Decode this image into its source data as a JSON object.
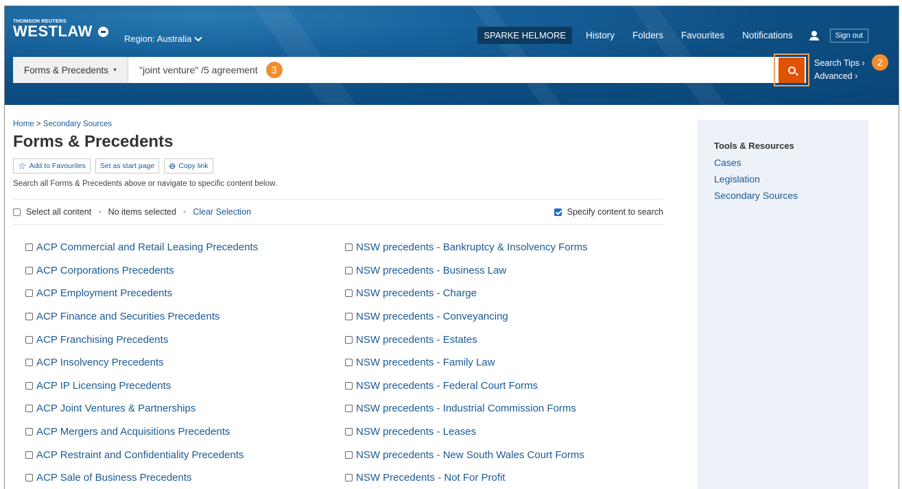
{
  "header": {
    "brand_small": "THOMSON REUTERS",
    "brand_big": "WESTLAW",
    "region": "Region: Australia",
    "firm": "SPARKE HELMORE",
    "nav": [
      "History",
      "Folders",
      "Favourites",
      "Notifications"
    ],
    "sign_out": "Sign out"
  },
  "search": {
    "scope": "Forms & Precedents",
    "query": "\"joint venture\" /5 agreement",
    "search_tips": "Search Tips",
    "advanced": "Advanced",
    "badge_query": "3",
    "badge_button": "2"
  },
  "page": {
    "breadcrumb_home": "Home",
    "breadcrumb_current": "Secondary Sources",
    "title": "Forms & Precedents",
    "add_favourites": "Add to Favourites",
    "set_start": "Set as start page",
    "copy_link": "Copy link",
    "description": "Search all Forms & Precedents above or navigate to specific content below.",
    "select_all": "Select all content",
    "no_items": "No items selected",
    "clear_selection": "Clear Selection",
    "specify": "Specify content to search"
  },
  "content_left": [
    "ACP Commercial and Retail Leasing Precedents",
    "ACP Corporations Precedents",
    "ACP Employment Precedents",
    "ACP Finance and Securities Precedents",
    "ACP Franchising Precedents",
    "ACP Insolvency Precedents",
    "ACP IP Licensing Precedents",
    "ACP Joint Ventures & Partnerships",
    "ACP Mergers and Acquisitions Precedents",
    "ACP Restraint and Confidentiality Precedents",
    "ACP Sale of Business Precedents"
  ],
  "content_right": [
    "NSW precedents - Bankruptcy & Insolvency Forms",
    "NSW precedents - Business Law",
    "NSW precedents - Charge",
    "NSW precedents - Conveyancing",
    "NSW precedents - Estates",
    "NSW precedents - Family Law",
    "NSW precedents - Federal Court Forms",
    "NSW precedents - Industrial Commission Forms",
    "NSW precedents - Leases",
    "NSW precedents - New South Wales Court Forms",
    "NSW Precedents - Not For Profit"
  ],
  "sidebar": {
    "heading": "Tools & Resources",
    "links": [
      "Cases",
      "Legislation",
      "Secondary Sources"
    ]
  },
  "colors": {
    "header_blue": "#0d4e82",
    "accent_orange": "#e05206",
    "link_blue": "#1a5a96",
    "badge_orange": "#f28c2e"
  }
}
